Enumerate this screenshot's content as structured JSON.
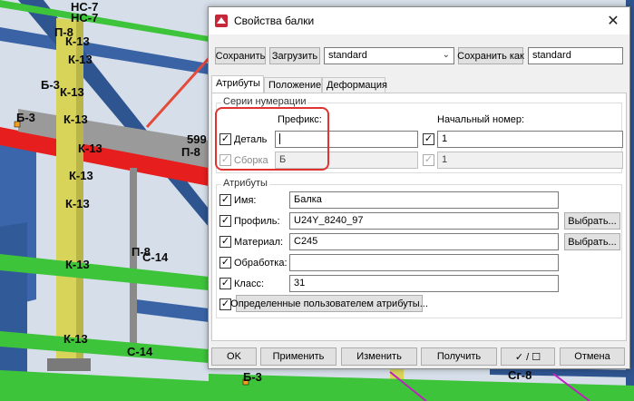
{
  "viewport": {
    "labels": [
      "НС-7",
      "НС-7",
      "К-13",
      "К-13",
      "П-8",
      "Б-3",
      "Б-3",
      "К-13",
      "К-13",
      "К-13",
      "К-13",
      "К-13",
      "К-13",
      "П-8",
      "С-14",
      "599",
      "П-8",
      "К-13",
      "Б-3",
      "Сг-8",
      "С-14"
    ]
  },
  "colors": {
    "beam_green": "#3dc43a",
    "beam_red": "#e61e1e",
    "column_yellow": "#d8d45a",
    "beam_gray": "#8a8a8a",
    "steel_blue": "#3a63a6",
    "highlight_red": "#e0332f",
    "arrow_red": "#e34b3b"
  },
  "dialog": {
    "title": "Свойства балки",
    "toolbar": {
      "save": "Сохранить",
      "load": "Загрузить",
      "preset_value": "standard",
      "save_as": "Сохранить как",
      "save_as_value": "standard"
    },
    "tabs": [
      "Атрибуты",
      "Положение",
      "Деформация"
    ],
    "numbering": {
      "group_title": "Серии нумерации",
      "prefix_header": "Префикс:",
      "start_header": "Начальный номер:",
      "rows": [
        {
          "label": "Деталь",
          "prefix": "",
          "start": "1"
        },
        {
          "label": "Сборка",
          "prefix": "Б",
          "start": "1"
        }
      ]
    },
    "attributes": {
      "group_title": "Атрибуты",
      "rows": [
        {
          "label": "Имя:",
          "value": "Балка"
        },
        {
          "label": "Профиль:",
          "value": "U24Y_8240_97",
          "button": "Выбрать..."
        },
        {
          "label": "Материал:",
          "value": "C245",
          "button": "Выбрать..."
        },
        {
          "label": "Обработка:",
          "value": ""
        },
        {
          "label": "Класс:",
          "value": "31"
        }
      ],
      "user_defined_button": "Определенные пользователем атрибуты..."
    },
    "footer": {
      "ok": "OK",
      "apply": "Применить",
      "modify": "Изменить",
      "get": "Получить",
      "toggle": "✓ / ☐",
      "cancel": "Отмена"
    }
  }
}
